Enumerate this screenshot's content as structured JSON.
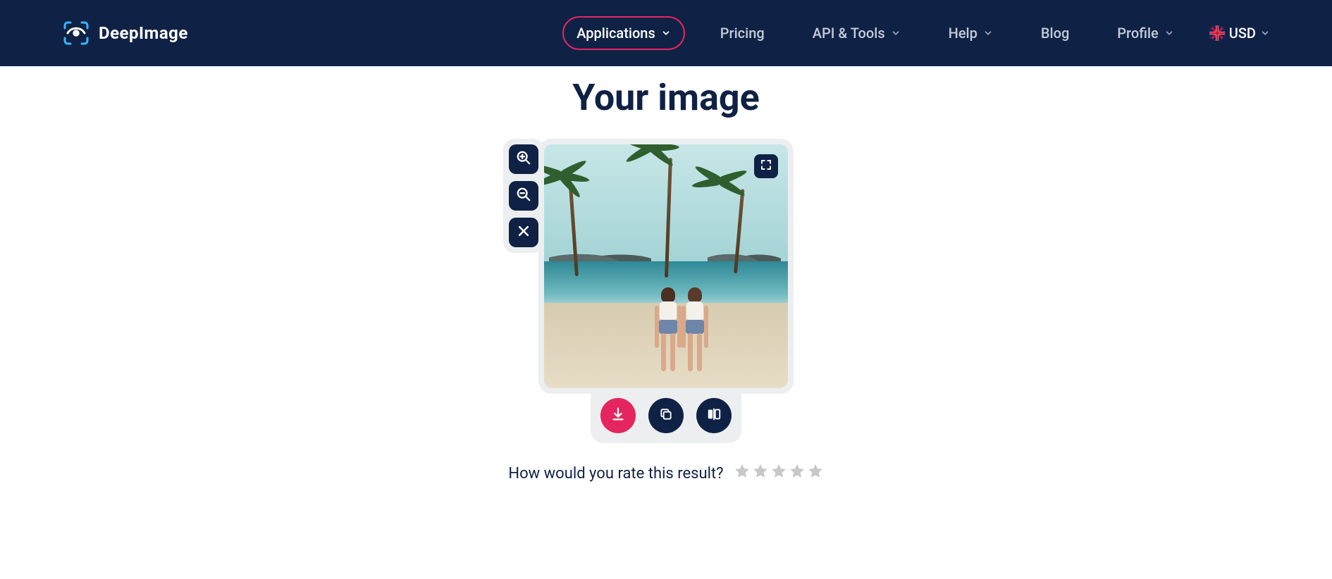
{
  "brand": {
    "name": "DeepImage"
  },
  "nav": {
    "applications": "Applications",
    "pricing": "Pricing",
    "api_tools": "API & Tools",
    "help": "Help",
    "blog": "Blog",
    "profile": "Profile",
    "currency": "USD"
  },
  "main": {
    "title": "Your image",
    "rating_prompt": "How would you rate this result?"
  },
  "tools": {
    "zoom_in": "zoom-in",
    "zoom_out": "zoom-out",
    "close": "close",
    "fullscreen": "fullscreen",
    "download": "download",
    "copy": "copy",
    "compare": "compare"
  }
}
